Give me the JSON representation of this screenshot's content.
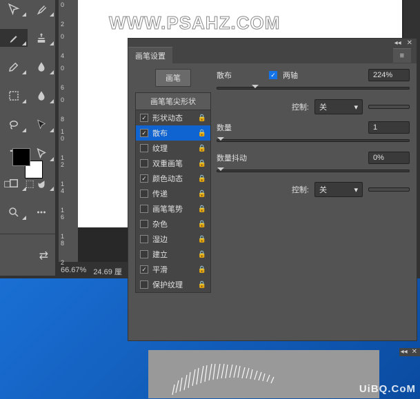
{
  "toolbar": {
    "tools": [
      "move",
      "eyedropper",
      "brush",
      "clone",
      "pen-alt",
      "drop",
      "rect-select",
      "bucket",
      "magnify-alt",
      "hand",
      "text",
      "direct-select",
      "shape",
      "hand2",
      "zoom",
      "more"
    ]
  },
  "swatch": {
    "fg": "#000000",
    "bg": "#ffffff"
  },
  "ruler": {
    "marks": [
      "0",
      "2",
      "0",
      "4",
      "0",
      "6",
      "0",
      "8",
      "1",
      "0",
      "1",
      "2",
      "1",
      "4",
      "1",
      "6",
      "1",
      "8",
      "2"
    ]
  },
  "canvas": {
    "watermark": "WWW.PSAHZ.COM"
  },
  "status": {
    "zoom": "66.67%",
    "dim": "24.69 厘"
  },
  "panel": {
    "title": "画笔设置",
    "brush_btn": "画笔",
    "tip_header": "画笔笔尖形状",
    "options": [
      {
        "label": "形状动态",
        "checked": true
      },
      {
        "label": "散布",
        "checked": true,
        "selected": true
      },
      {
        "label": "纹理",
        "checked": false
      },
      {
        "label": "双重画笔",
        "checked": false
      },
      {
        "label": "颜色动态",
        "checked": true
      },
      {
        "label": "传递",
        "checked": false
      },
      {
        "label": "画笔笔势",
        "checked": false
      },
      {
        "label": "杂色",
        "checked": false
      },
      {
        "label": "湿边",
        "checked": false
      },
      {
        "label": "建立",
        "checked": false
      },
      {
        "label": "平滑",
        "checked": true
      },
      {
        "label": "保护纹理",
        "checked": false
      }
    ],
    "scatter": {
      "label": "散布",
      "both_axes_label": "两轴",
      "both_axes": true,
      "value": "224%",
      "control_label": "控制:",
      "control_value": "关",
      "count_label": "数量",
      "count_value": "1",
      "jitter_label": "数量抖动",
      "jitter_value": "0%",
      "control2_value": "关"
    }
  },
  "footer_watermark": "UiBQ.CoM"
}
